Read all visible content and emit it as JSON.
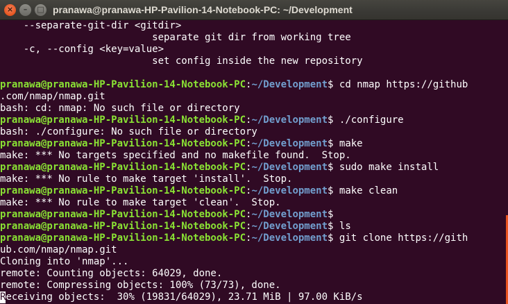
{
  "window": {
    "title": "pranawa@pranawa-HP-Pavilion-14-Notebook-PC: ~/Development",
    "close_glyph": "×",
    "minimize_glyph": "–",
    "maximize_glyph": "□"
  },
  "prompt": {
    "user_host": "pranawa@pranawa-HP-Pavilion-14-Notebook-PC",
    "sep": ":",
    "path": "~/Development",
    "suffix": "$ "
  },
  "terminal": {
    "help": [
      "    --separate-git-dir <gitdir>",
      "                          separate git dir from working tree",
      "    -c, --config <key=value>",
      "                          set config inside the new repository"
    ],
    "cmd1": "cd nmap https://github",
    "cmd1_wrap": ".com/nmap/nmap.git",
    "out1": "bash: cd: nmap: No such file or directory",
    "cmd2": "./configure",
    "out2": "bash: ./configure: No such file or directory",
    "cmd3": "make",
    "out3": "make: *** No targets specified and no makefile found.  Stop.",
    "cmd4": "sudo make install",
    "out4": "make: *** No rule to make target 'install'.  Stop.",
    "cmd5": "make clean",
    "out5": "make: *** No rule to make target 'clean'.  Stop.",
    "cmd6": "",
    "cmd7": "ls",
    "cmd8": "git clone https://gith",
    "cmd8_wrap": "ub.com/nmap/nmap.git",
    "clone_out": [
      "Cloning into 'nmap'...",
      "remote: Counting objects: 64029, done.",
      "remote: Compressing objects: 100% (73/73), done."
    ],
    "progress_cursor_char": "R",
    "progress_rest": "eceiving objects:  30% (19831/64029), 23.71 MiB | 97.00 KiB/s"
  },
  "colors": {
    "background": "#300a24",
    "prompt_user": "#8ae234",
    "prompt_path": "#729fcf",
    "text": "#ffffff",
    "scrollbar": "#e95420"
  }
}
